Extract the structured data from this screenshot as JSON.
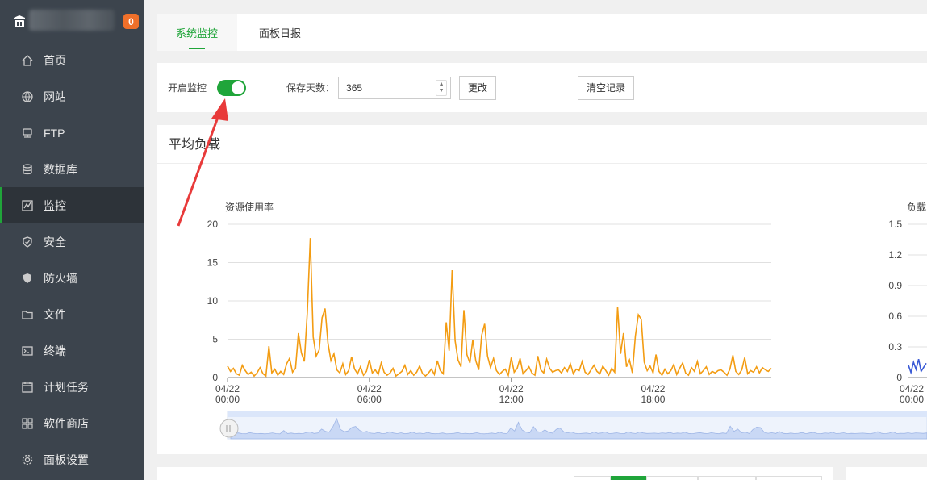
{
  "sidebar": {
    "badge": "0",
    "items": [
      {
        "label": "首页",
        "icon": "home-icon"
      },
      {
        "label": "网站",
        "icon": "globe-icon"
      },
      {
        "label": "FTP",
        "icon": "ftp-icon"
      },
      {
        "label": "数据库",
        "icon": "database-icon"
      },
      {
        "label": "监控",
        "icon": "monitor-icon",
        "active": true
      },
      {
        "label": "安全",
        "icon": "shield-icon"
      },
      {
        "label": "防火墙",
        "icon": "firewall-icon"
      },
      {
        "label": "文件",
        "icon": "folder-icon"
      },
      {
        "label": "终端",
        "icon": "terminal-icon"
      },
      {
        "label": "计划任务",
        "icon": "clock-icon"
      },
      {
        "label": "软件商店",
        "icon": "grid-icon"
      },
      {
        "label": "面板设置",
        "icon": "gear-icon"
      }
    ]
  },
  "tabs": [
    {
      "label": "系统监控",
      "active": true
    },
    {
      "label": "面板日报",
      "active": false
    }
  ],
  "controls": {
    "monitor_label": "开启监控",
    "monitor_enabled": true,
    "days_label": "保存天数：",
    "days_value": "365",
    "change_button": "更改",
    "clear_button": "清空记录"
  },
  "panel": {
    "title": "平均负载"
  },
  "colors": {
    "accent": "#20a53a",
    "line": "#f39c12",
    "annotation_arrow": "#e83a3a",
    "sidebar_bg": "#3c444d"
  },
  "chart_data": [
    {
      "type": "line",
      "title": "资源使用率",
      "ylim": [
        0,
        20
      ],
      "yticks": [
        "0",
        "5",
        "10",
        "15",
        "20"
      ],
      "xticks": [
        "04/22\n00:00",
        "04/22\n06:00",
        "04/22\n12:00",
        "04/22\n18:00"
      ],
      "x_range_hours": [
        0,
        23
      ],
      "grid": true,
      "series": [
        {
          "values": [
            1.5,
            0.8,
            1.2,
            0.5,
            0.3,
            1.6,
            0.9,
            0.4,
            0.7,
            0.2,
            0.6,
            1.3,
            0.5,
            0.2,
            4.1,
            0.6,
            1.1,
            0.3,
            0.8,
            0.4,
            1.8,
            2.5,
            0.7,
            1.2,
            5.8,
            3.2,
            2.1,
            8.5,
            18.2,
            5.3,
            2.8,
            3.6,
            7.8,
            9.0,
            4.5,
            2.2,
            3.1,
            1.0,
            0.6,
            1.8,
            0.4,
            0.9,
            2.7,
            1.1,
            0.5,
            1.4,
            0.3,
            0.8,
            2.3,
            0.6,
            1.0,
            0.4,
            1.9,
            0.7,
            0.3,
            0.6,
            1.2,
            0.2,
            0.5,
            0.8,
            1.6,
            0.4,
            0.9,
            0.3,
            0.7,
            1.5,
            0.5,
            0.2,
            0.6,
            1.1,
            0.4,
            2.2,
            0.9,
            0.5,
            7.2,
            3.5,
            14.0,
            4.8,
            2.3,
            1.4,
            8.8,
            3.0,
            1.9,
            4.9,
            2.2,
            1.0,
            5.5,
            7.0,
            2.8,
            1.3,
            2.5,
            0.9,
            0.4,
            0.8,
            1.1,
            0.3,
            2.6,
            0.7,
            1.2,
            2.5,
            0.5,
            0.9,
            1.4,
            0.6,
            0.3,
            2.8,
            1.0,
            0.6,
            2.4,
            1.2,
            0.7,
            0.9,
            1.0,
            0.6,
            1.3,
            0.8,
            1.8,
            0.5,
            1.1,
            0.9,
            2.1,
            0.7,
            0.4,
            1.0,
            1.6,
            0.8,
            0.5,
            1.5,
            0.9,
            0.3,
            1.2,
            0.7,
            9.2,
            3.1,
            5.8,
            1.4,
            2.3,
            0.6,
            5.4,
            8.2,
            7.6,
            2.0,
            0.9,
            1.5,
            0.6,
            3.0,
            0.8,
            0.3,
            1.1,
            0.5,
            0.9,
            1.7,
            0.4,
            1.2,
            1.9,
            0.6,
            0.3,
            1.3,
            0.8,
            2.1,
            0.5,
            0.9,
            1.4,
            0.4,
            0.8,
            0.6,
            0.9,
            1.0,
            0.7,
            0.3,
            1.1,
            2.9,
            0.8,
            0.4,
            1.0,
            2.6,
            0.5,
            0.9,
            0.7,
            1.4,
            0.6,
            1.3,
            1.0,
            0.8,
            1.2
          ]
        }
      ]
    },
    {
      "type": "line",
      "title": "负载",
      "ylim": [
        0,
        1.5
      ],
      "yticks": [
        "0",
        "0.3",
        "0.6",
        "0.9",
        "1.2",
        "1.5"
      ],
      "xticks": [
        "04/22\n00:00"
      ],
      "grid": true,
      "series": [
        {
          "values": [
            0.12,
            0.05,
            0.15,
            0.08,
            0.18,
            0.06,
            0.1,
            0.14
          ]
        }
      ]
    }
  ]
}
